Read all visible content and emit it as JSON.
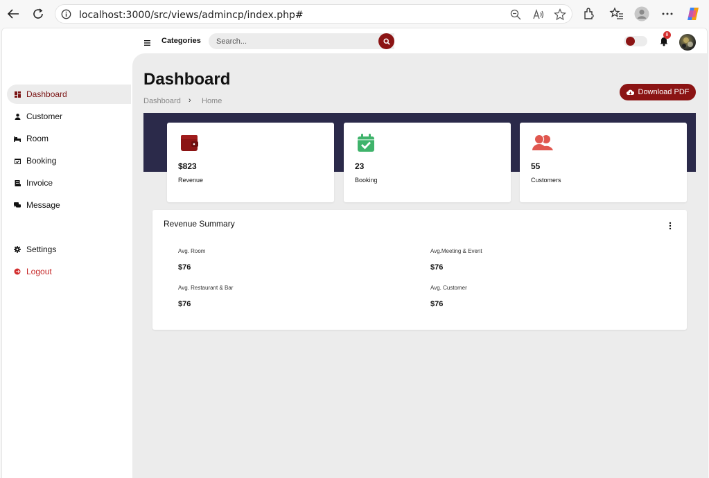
{
  "browser": {
    "url_main": "localhost:3000/src/views/admincp/index.php#",
    "icons": [
      "back-arrow-icon",
      "reload-icon",
      "info-icon",
      "zoom-out-icon",
      "read-aloud-icon",
      "favorite-star-icon",
      "extensions-icon",
      "favorites-icon",
      "profile-icon",
      "more-icon",
      "copilot-icon"
    ]
  },
  "sidebar": {
    "items": [
      {
        "label": "Dashboard",
        "icon": "dashboard-icon"
      },
      {
        "label": "Customer",
        "icon": "user-icon"
      },
      {
        "label": "Room",
        "icon": "bed-icon"
      },
      {
        "label": "Booking",
        "icon": "calendar-check-icon"
      },
      {
        "label": "Invoice",
        "icon": "invoice-icon"
      },
      {
        "label": "Message",
        "icon": "message-icon"
      },
      {
        "label": "Settings",
        "icon": "gear-icon"
      },
      {
        "label": "Logout",
        "icon": "logout-icon"
      }
    ],
    "active": "Dashboard"
  },
  "header": {
    "categories_label": "Categories",
    "search_placeholder": "Search...",
    "notification_count": "8",
    "theme_toggle": "dark-mode-toggle"
  },
  "main": {
    "title": "Dashboard",
    "breadcrumb": [
      "Dashboard",
      "Home"
    ],
    "breadcrumb_separator": "›",
    "download_label": "Download PDF",
    "cards": [
      {
        "value": "$823",
        "label": "Revenue",
        "icon": "wallet-icon",
        "color": "#8b1414"
      },
      {
        "value": "23",
        "label": "Booking",
        "icon": "calendar-check-icon",
        "color": "#3fb36b"
      },
      {
        "value": "55",
        "label": "Customers",
        "icon": "users-icon",
        "color": "#e0574f"
      }
    ],
    "summary": {
      "title": "Revenue Summary",
      "stats": [
        {
          "label": "Avg. Room",
          "value": "$76"
        },
        {
          "label": "Avg.Meeting & Event",
          "value": "$76"
        },
        {
          "label": "Avg. Restaurant & Bar",
          "value": "$76"
        },
        {
          "label": "Avg. Customer",
          "value": "$76"
        }
      ]
    }
  },
  "colors": {
    "accent": "#8b1414",
    "banner": "#2b2a4a",
    "background": "#ececec"
  }
}
